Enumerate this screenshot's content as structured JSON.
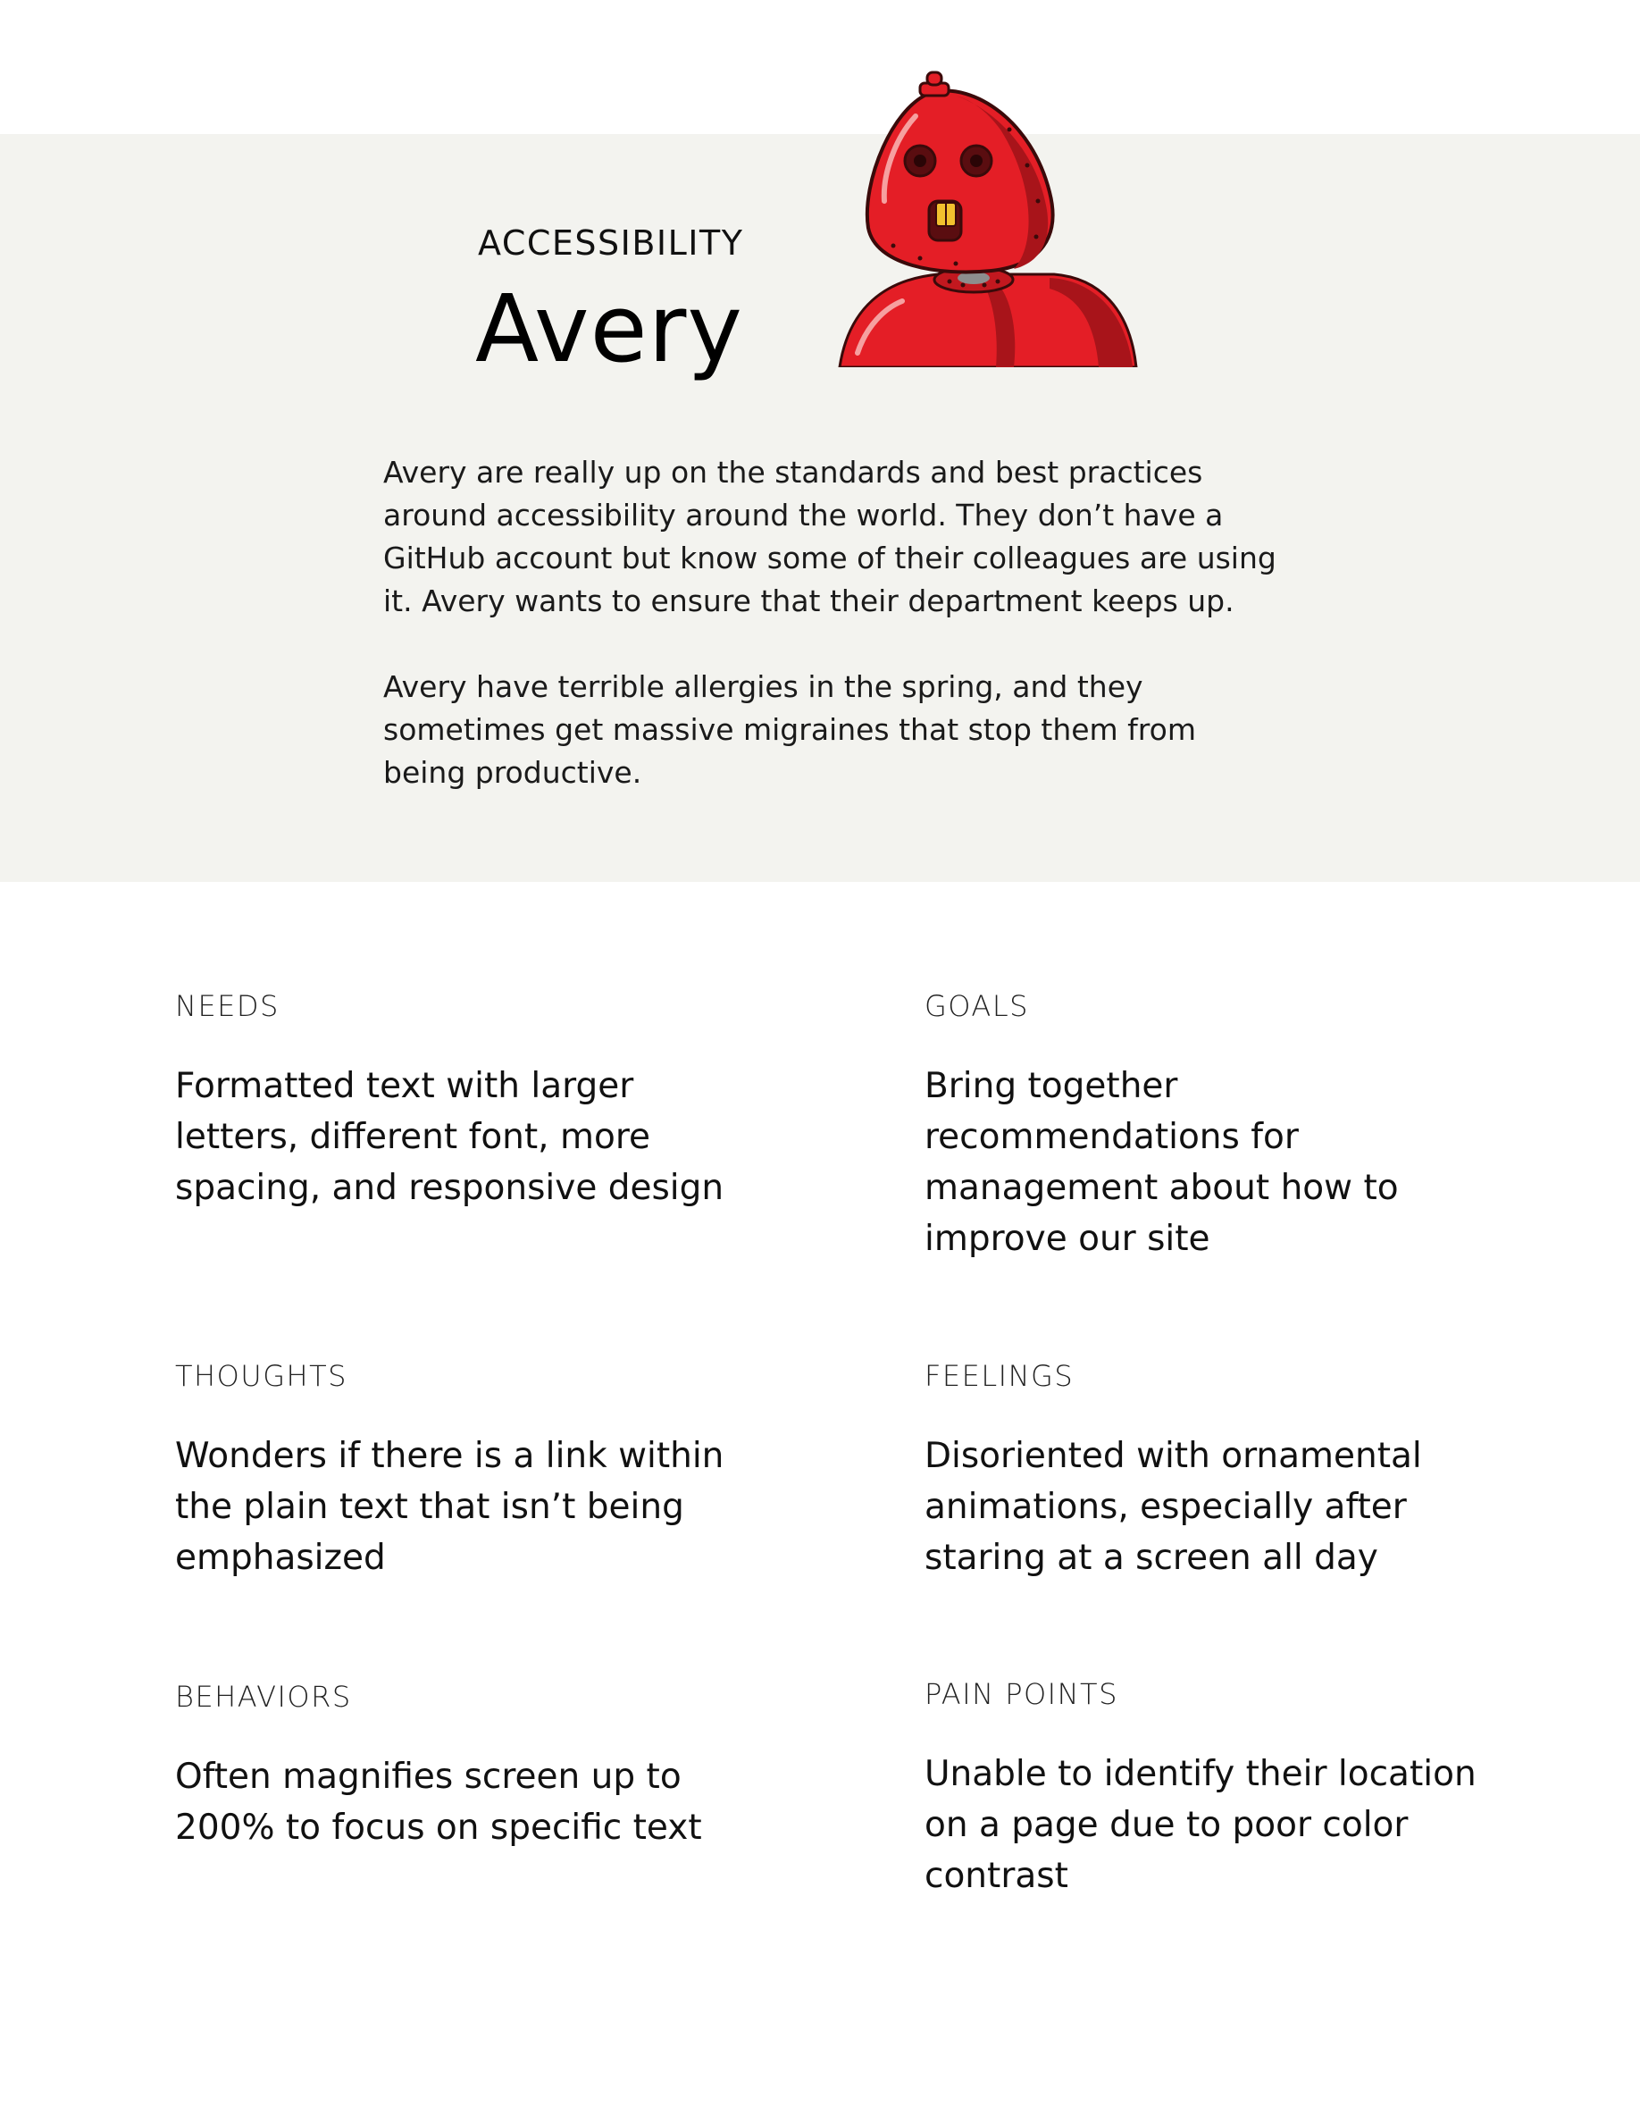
{
  "persona": {
    "category": "ACCESSIBILITY",
    "name": "Avery",
    "avatar_icon": "red-robot-avatar",
    "avatar_colors": {
      "body": "#e41e26",
      "shadow": "#a8141a",
      "outline": "#3a0a0a",
      "tooth": "#f2c12e"
    },
    "bio": [
      "Avery are really up on the standards and best practices around accessibility around the world. They don’t have a GitHub account but know some of their colleagues are using it. Avery wants to ensure that their department keeps up.",
      "Avery have terrible allergies in the spring, and they sometimes get massive migraines that stop them from being productive."
    ]
  },
  "sections": {
    "needs": {
      "label": "NEEDS",
      "text": "Formatted text with larger letters, different font, more spacing, and responsive design"
    },
    "goals": {
      "label": "GOALS",
      "text": "Bring together recommendations for management about how to improve our site"
    },
    "thoughts": {
      "label": "THOUGHTS",
      "text": "Wonders if there is a link within the plain text that isn’t being emphasized"
    },
    "feelings": {
      "label": "FEELINGS",
      "text": "Disoriented with ornamental animations, especially after staring at a screen all day"
    },
    "behaviors": {
      "label": "BEHAVIORS",
      "text": "Often magnifies screen up to 200% to focus on specific text"
    },
    "pain_points": {
      "label": "PAIN POINTS",
      "text": "Unable to identify their location on a page due to poor color contrast"
    }
  },
  "colors": {
    "hero_background": "#f3f3ef",
    "page_background": "#ffffff",
    "text": "#111111"
  }
}
